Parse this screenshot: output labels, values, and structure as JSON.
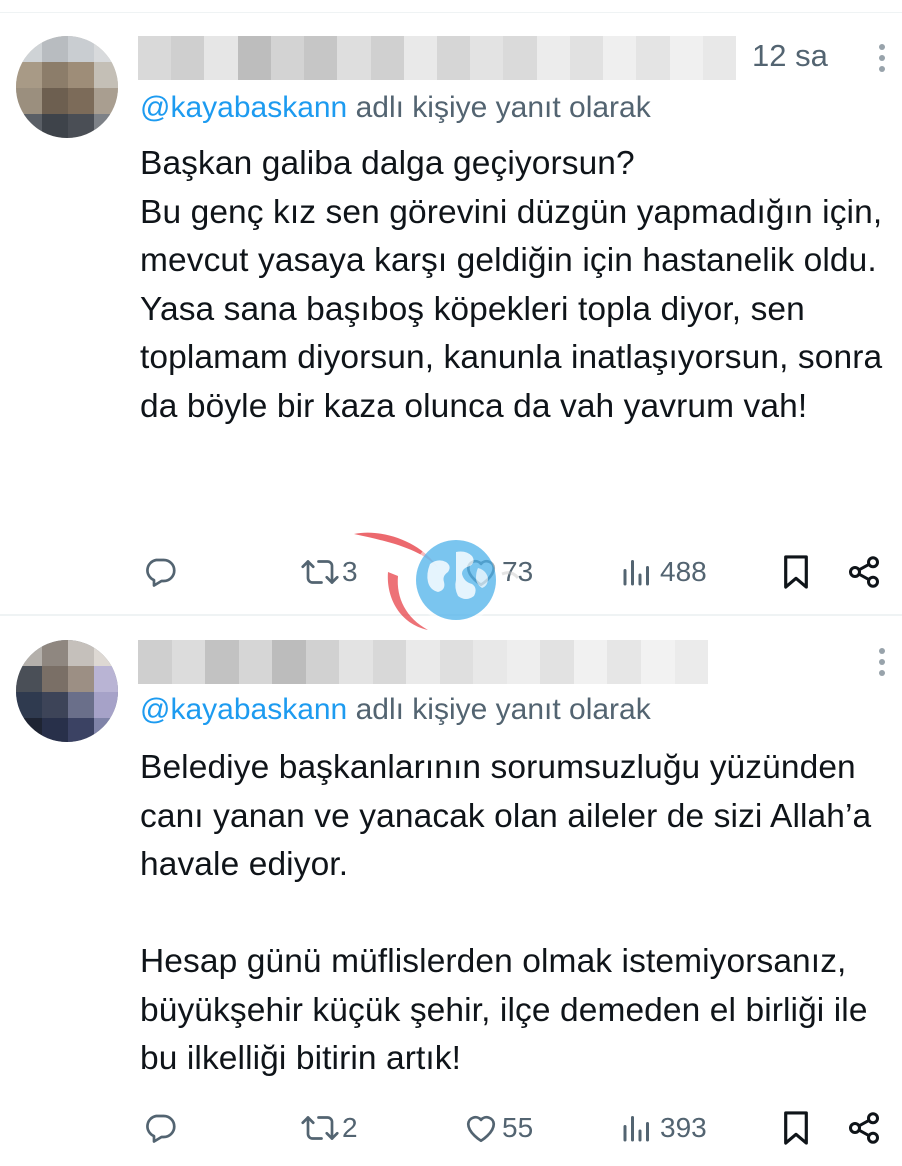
{
  "tweets": [
    {
      "time": "12 sa",
      "reply_handle": "@kayabaskann",
      "reply_suffix": " adlı kişiye yanıt olarak",
      "text": "Başkan galiba dalga geçiyorsun?\nBu genç kız sen görevini düzgün yapmadığın için, mevcut yasaya karşı geldiğin için hastanelik oldu.\nYasa sana başıboş köpekleri topla diyor, sen toplamam diyorsun, kanunla inatlaşıyorsun, sonra da böyle bir kaza olunca da vah yavrum vah!",
      "retweets": "3",
      "likes": "73",
      "views": "488"
    },
    {
      "time": "",
      "reply_handle": "@kayabaskann",
      "reply_suffix": " adlı kişiye yanıt olarak",
      "text": "Belediye başkanlarının sorumsuzluğu yüzünden canı yanan ve yanacak olan aileler de sizi Allah’a havale ediyor.\n\nHesap günü müflislerden olmak istemiyorsanız, büyükşehir küçük şehir, ilçe demeden el birliği ile bu ilkelliği bitirin artık!",
      "retweets": "2",
      "likes": "55",
      "views": "393"
    }
  ],
  "icons": {
    "reply": "reply-icon",
    "retweet": "retweet-icon",
    "like": "heart-icon",
    "views": "views-icon",
    "bookmark": "bookmark-icon",
    "share": "share-icon",
    "more": "more-icon"
  },
  "colors": {
    "text": "#0f1419",
    "secondary": "#536471",
    "link": "#1d9bf0",
    "divider": "#eff3f4",
    "watermark_red": "#e3232b",
    "watermark_blue": "#1f8fd6"
  }
}
